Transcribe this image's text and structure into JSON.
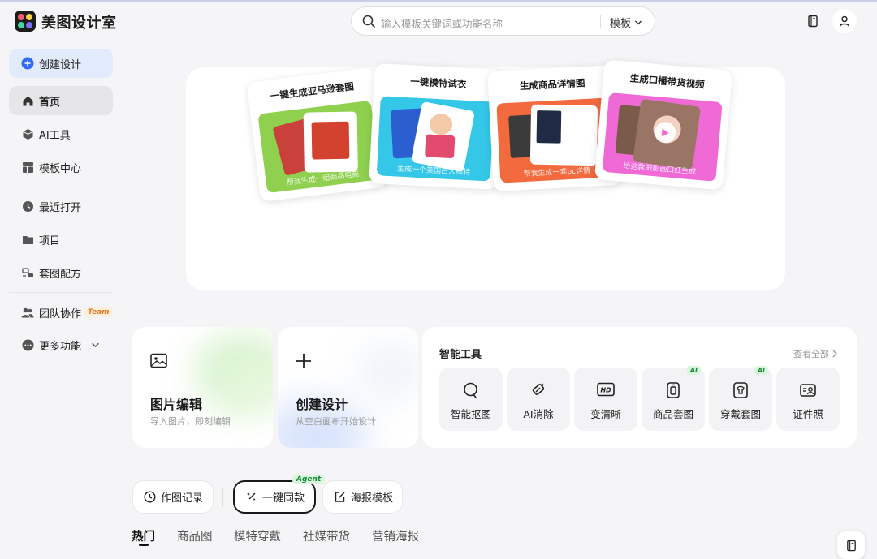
{
  "app": {
    "title": "美图设计室"
  },
  "search": {
    "placeholder": "输入模板关键词或功能名称",
    "scope": "模板"
  },
  "sidebar": {
    "create_label": "创建设计",
    "items": [
      {
        "label": "首页",
        "icon": "home-icon"
      },
      {
        "label": "AI工具",
        "icon": "cube-icon"
      },
      {
        "label": "模板中心",
        "icon": "layout-icon"
      },
      {
        "label": "最近打开",
        "icon": "clock-icon"
      },
      {
        "label": "项目",
        "icon": "folder-icon"
      },
      {
        "label": "套图配方",
        "icon": "recipe-icon"
      },
      {
        "label": "团队协作",
        "icon": "team-icon",
        "badge": "Team"
      },
      {
        "label": "更多功能",
        "icon": "more-icon"
      }
    ]
  },
  "banner": {
    "cards": [
      {
        "title": "一键生成亚马逊套图",
        "caption": "帮我生成一组商品电商",
        "color": "#8fd14f"
      },
      {
        "title": "一键模特试衣",
        "caption": "生成一个美国白人模特",
        "color": "#35c7e8"
      },
      {
        "title": "生成商品详情图",
        "caption": "帮我生成一套pc详情",
        "color": "#f26a3e"
      },
      {
        "title": "生成口播带货视频",
        "caption": "给这款眼影画口红生成",
        "color": "#f06ad6"
      }
    ]
  },
  "actions": {
    "edit": {
      "title": "图片编辑",
      "subtitle": "导入图片，即刻编辑"
    },
    "create": {
      "title": "创建设计",
      "subtitle": "从空白画布开始设计"
    }
  },
  "tools": {
    "title": "智能工具",
    "view_all": "查看全部",
    "items": [
      {
        "label": "智能抠图",
        "icon": "cutout-icon",
        "ai": ""
      },
      {
        "label": "AI消除",
        "icon": "eraser-icon",
        "ai": ""
      },
      {
        "label": "变清晰",
        "icon": "hd-icon",
        "ai": ""
      },
      {
        "label": "商品套图",
        "icon": "product-set-icon",
        "ai": "AI"
      },
      {
        "label": "穿戴套图",
        "icon": "wear-set-icon",
        "ai": "AI"
      },
      {
        "label": "证件照",
        "icon": "id-photo-icon",
        "ai": ""
      }
    ]
  },
  "pills": {
    "history": "作图记录",
    "same_style": "一键同款",
    "agent_badge": "Agent",
    "poster": "海报模板"
  },
  "tabs": [
    "热门",
    "商品图",
    "模特穿戴",
    "社媒带货",
    "营销海报"
  ]
}
